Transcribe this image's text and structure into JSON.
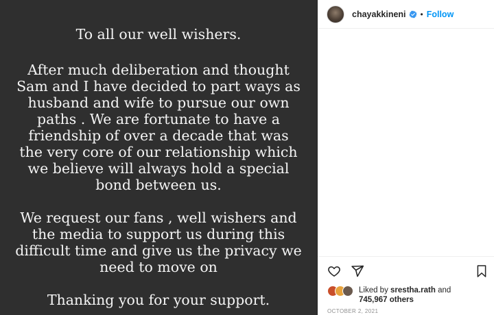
{
  "post": {
    "message": {
      "salutation": "To all our well wishers.",
      "paragraph1": "After much deliberation and thought Sam and I have decided to part ways as husband and wife to pursue our own paths . We are fortunate to have a friendship of over a decade that was the very core of our relationship which we believe will always hold a special bond between us.",
      "paragraph2": "We request our fans , well wishers and the media to support us during this difficult time and give us the privacy we need to move on",
      "closing": "Thanking you for your support."
    }
  },
  "header": {
    "username": "chayakkineni",
    "separator": "•",
    "follow_label": "Follow",
    "verified_color": "#3897f0"
  },
  "actions": {
    "icons": [
      "heart-icon",
      "share-icon",
      "bookmark-icon"
    ]
  },
  "likes": {
    "prefix": "Liked by ",
    "user": "srestha.rath",
    "and": " and",
    "count": "745,967 others"
  },
  "date": "OCTOBER 2, 2021",
  "colors": {
    "media_bg": "#2f2f2f",
    "text_light": "#f4f4f4",
    "link": "#0095f6"
  }
}
